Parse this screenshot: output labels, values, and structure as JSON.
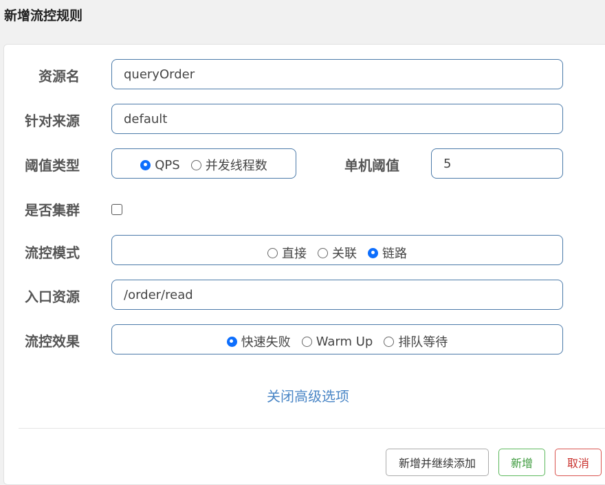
{
  "dialog": {
    "title": "新增流控规则"
  },
  "form": {
    "resource_name": {
      "label": "资源名",
      "value": "queryOrder"
    },
    "limit_app": {
      "label": "针对来源",
      "value": "default"
    },
    "grade": {
      "label": "阈值类型",
      "options": [
        {
          "label": "QPS",
          "selected": true
        },
        {
          "label": "并发线程数",
          "selected": false
        }
      ]
    },
    "count": {
      "label": "单机阈值",
      "value": "5"
    },
    "cluster": {
      "label": "是否集群",
      "checked": false
    },
    "strategy": {
      "label": "流控模式",
      "options": [
        {
          "label": "直接",
          "selected": false
        },
        {
          "label": "关联",
          "selected": false
        },
        {
          "label": "链路",
          "selected": true
        }
      ]
    },
    "ref_resource": {
      "label": "入口资源",
      "value": "/order/read"
    },
    "control_behavior": {
      "label": "流控效果",
      "options": [
        {
          "label": "快速失败",
          "selected": true
        },
        {
          "label": "Warm Up",
          "selected": false
        },
        {
          "label": "排队等待",
          "selected": false
        }
      ]
    },
    "advanced_toggle": "关闭高级选项"
  },
  "footer": {
    "add_continue": "新增并继续添加",
    "add": "新增",
    "cancel": "取消"
  },
  "colors": {
    "field_border": "#4a79a8",
    "radio_selected": "#0d6efd",
    "link": "#4a86c6",
    "ok": "#5cb85c",
    "cancel": "#d9534f"
  }
}
